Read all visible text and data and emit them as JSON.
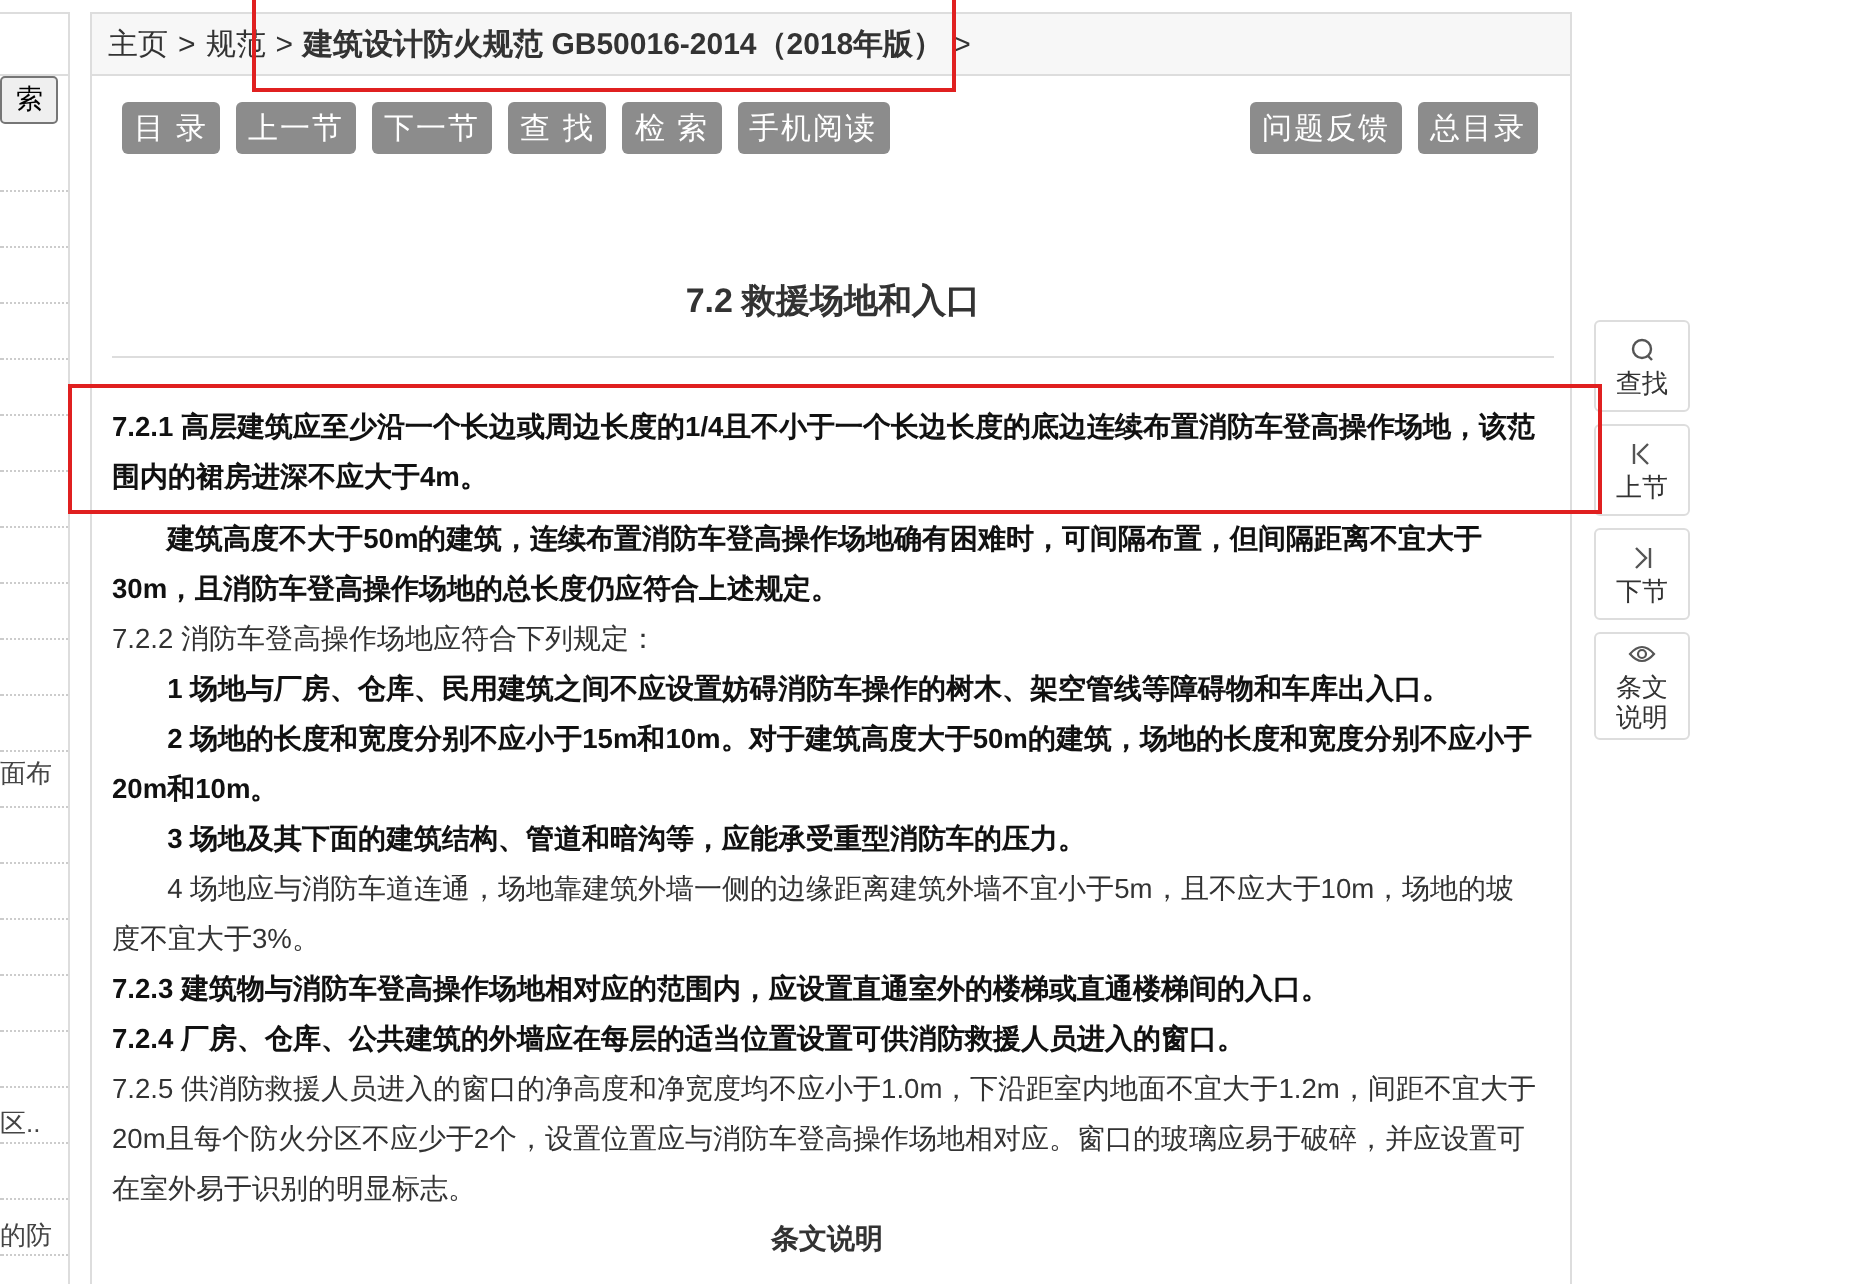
{
  "sidebar": {
    "search_button": "索",
    "items": [
      "面布",
      "区..",
      "的防"
    ]
  },
  "breadcrumb": [
    {
      "label": "主页",
      "highlight": false
    },
    {
      "label": "规范",
      "highlight": false
    },
    {
      "label": "建筑设计防火规范 GB50016-2014（2018年版）",
      "highlight": true
    }
  ],
  "breadcrumb_separator": ">",
  "toolbar": {
    "left": [
      "目 录",
      "上一节",
      "下一节",
      "查 找",
      "检 索",
      "手机阅读"
    ],
    "right": [
      "问题反馈",
      "总目录"
    ]
  },
  "title": "7.2  救援场地和入口",
  "paragraphs": [
    {
      "text": "7.2.1 高层建筑应至少沿一个长边或周边长度的1/4且不小于一个长边长度的底边连续布置消防车登高操作场地，该范围内的裙房进深不应大于4m。",
      "bold": true,
      "indent": false,
      "highlight": true
    },
    {
      "text": "建筑高度不大于50m的建筑，连续布置消防车登高操作场地确有困难时，可间隔布置，但间隔距离不宜大于30m，且消防车登高操作场地的总长度仍应符合上述规定。",
      "bold": true,
      "indent": true,
      "highlight": false
    },
    {
      "text": "7.2.2 消防车登高操作场地应符合下列规定：",
      "bold": false,
      "indent": false,
      "highlight": false
    },
    {
      "text": "1 场地与厂房、仓库、民用建筑之间不应设置妨碍消防车操作的树木、架空管线等障碍物和车库出入口。",
      "bold": true,
      "indent": true,
      "highlight": false
    },
    {
      "text": "2 场地的长度和宽度分别不应小于15m和10m。对于建筑高度大于50m的建筑，场地的长度和宽度分别不应小于20m和10m。",
      "bold": true,
      "indent": true,
      "highlight": false
    },
    {
      "text": "3 场地及其下面的建筑结构、管道和暗沟等，应能承受重型消防车的压力。",
      "bold": true,
      "indent": true,
      "highlight": false
    },
    {
      "text": "4 场地应与消防车道连通，场地靠建筑外墙一侧的边缘距离建筑外墙不宜小于5m，且不应大于10m，场地的坡度不宜大于3%。",
      "bold": false,
      "indent": true,
      "highlight": false
    },
    {
      "text": "7.2.3 建筑物与消防车登高操作场地相对应的范围内，应设置直通室外的楼梯或直通楼梯间的入口。",
      "bold": true,
      "indent": false,
      "highlight": false
    },
    {
      "text": "7.2.4 厂房、仓库、公共建筑的外墙应在每层的适当位置设置可供消防救援人员进入的窗口。",
      "bold": true,
      "indent": false,
      "highlight": false
    },
    {
      "text": "7.2.5 供消防救援人员进入的窗口的净高度和净宽度均不应小于1.0m，下沿距室内地面不宜大于1.2m，间距不宜大于20m且每个防火分区不应少于2个，设置位置应与消防车登高操作场地相对应。窗口的玻璃应易于破碎，并应设置可在室外易于识别的明显标志。",
      "bold": false,
      "indent": false,
      "highlight": false
    }
  ],
  "explanation_heading": "条文说明",
  "float_buttons": [
    {
      "kind": "search",
      "label": "查找"
    },
    {
      "kind": "prev",
      "label": "上节"
    },
    {
      "kind": "next",
      "label": "下节"
    },
    {
      "kind": "eye",
      "label": "条文说明"
    }
  ]
}
